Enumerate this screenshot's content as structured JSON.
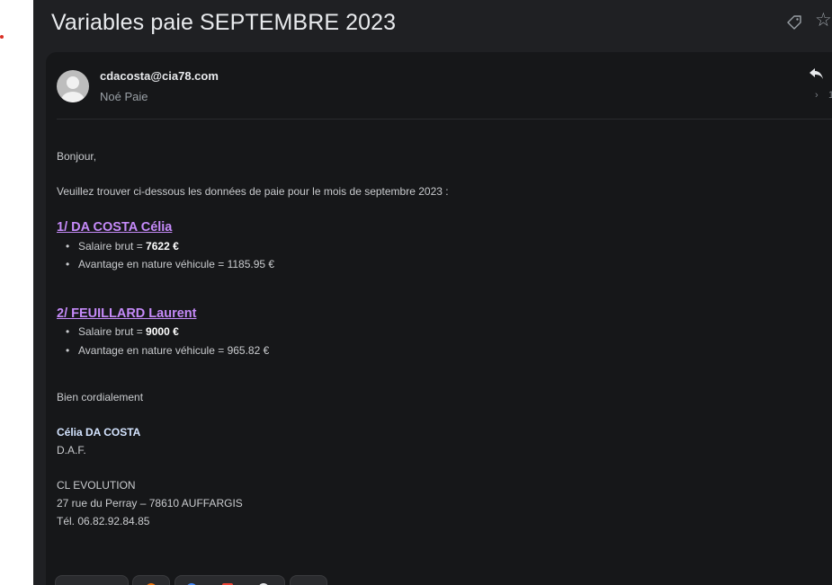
{
  "subject": "Variables paie SEPTEMBRE 2023",
  "header_icons": [
    "tag-icon",
    "star-icon"
  ],
  "sender": {
    "email": "cdacosta@cia78.com",
    "to": "Noé Paie"
  },
  "message": {
    "greeting": "Bonjour,",
    "intro": "Veuillez trouver ci-dessous les données de paie pour le mois de septembre 2023 :",
    "employees": [
      {
        "title": "1/ DA COSTA Célia",
        "salary_label": "Salaire brut = ",
        "salary_value": "7622 €",
        "benefit": "Avantage en nature véhicule = 1185.95 €"
      },
      {
        "title": "2/ FEUILLARD Laurent",
        "salary_label": "Salaire brut = ",
        "salary_value": "9000 €",
        "benefit": "Avantage en nature véhicule = 965.82 €"
      }
    ],
    "closing": "Bien cordialement",
    "signature": {
      "name": "Célia DA COSTA",
      "role": "D.A.F.",
      "company": "CL EVOLUTION",
      "address": "27 rue du Perray – 78610 AUFFARGIS",
      "phone": "Tél. 06.82.92.84.85"
    }
  },
  "colors": {
    "background": "#1f2023",
    "card": "#161719",
    "accent_link": "#c58af9",
    "signature_name": "#d4e4ff"
  }
}
